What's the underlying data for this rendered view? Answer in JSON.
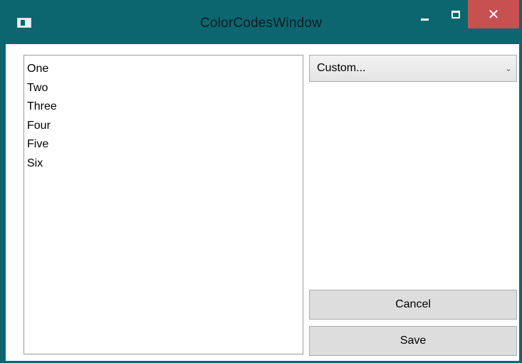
{
  "window": {
    "title": "ColorCodesWindow",
    "minimize_icon": "minimize-icon",
    "maximize_icon": "maximize-icon",
    "close_glyph": "✕",
    "close_color": "#c75050",
    "frame_color": "#0b6670"
  },
  "list": {
    "items": [
      "One",
      "Two",
      "Three",
      "Four",
      "Five",
      "Six"
    ]
  },
  "combo": {
    "selected": "Custom...",
    "arrow_glyph": "⌄"
  },
  "buttons": {
    "cancel_label": "Cancel",
    "save_label": "Save"
  }
}
